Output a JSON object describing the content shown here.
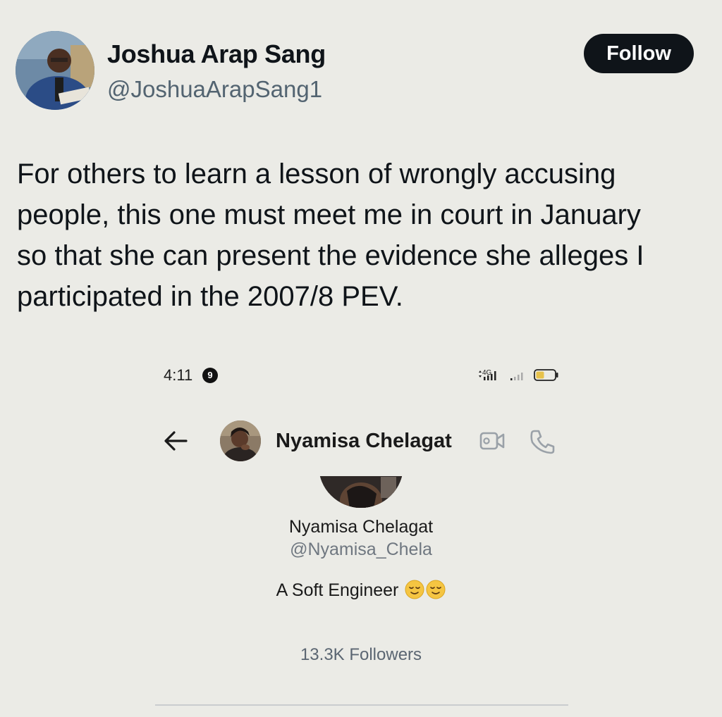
{
  "tweet": {
    "author_name": "Joshua Arap Sang",
    "author_handle": "@JoshuaArapSang1",
    "follow_label": "Follow",
    "text_lines": [
      "For others to learn a lesson of wrongly accusing",
      "people, this one must meet me in court in January",
      "so that she can present the evidence she alleges I",
      "participated in the 2007/8 PEV."
    ]
  },
  "embedded_screenshot": {
    "status_bar": {
      "time": "4:11",
      "notification_count": "9",
      "network_label": "4G",
      "icons": [
        "data-arrows-icon",
        "signal-bars-icon",
        "signal-bars-weak-icon",
        "battery-low-icon"
      ]
    },
    "chat_header": {
      "back_icon": "arrow-left-icon",
      "contact_name": "Nyamisa Chelagat",
      "video_icon": "video-camera-icon",
      "phone_icon": "phone-icon"
    },
    "profile": {
      "name": "Nyamisa Chelagat",
      "handle": "@Nyamisa_Chela",
      "bio": "A Soft Engineer",
      "bio_emoji": [
        "relieved-face-emoji",
        "relieved-face-emoji"
      ],
      "followers": "13.3K Followers"
    }
  },
  "colors": {
    "background": "#ebebe6",
    "follow_button": "#0f1419",
    "handle_gray": "#536471"
  }
}
